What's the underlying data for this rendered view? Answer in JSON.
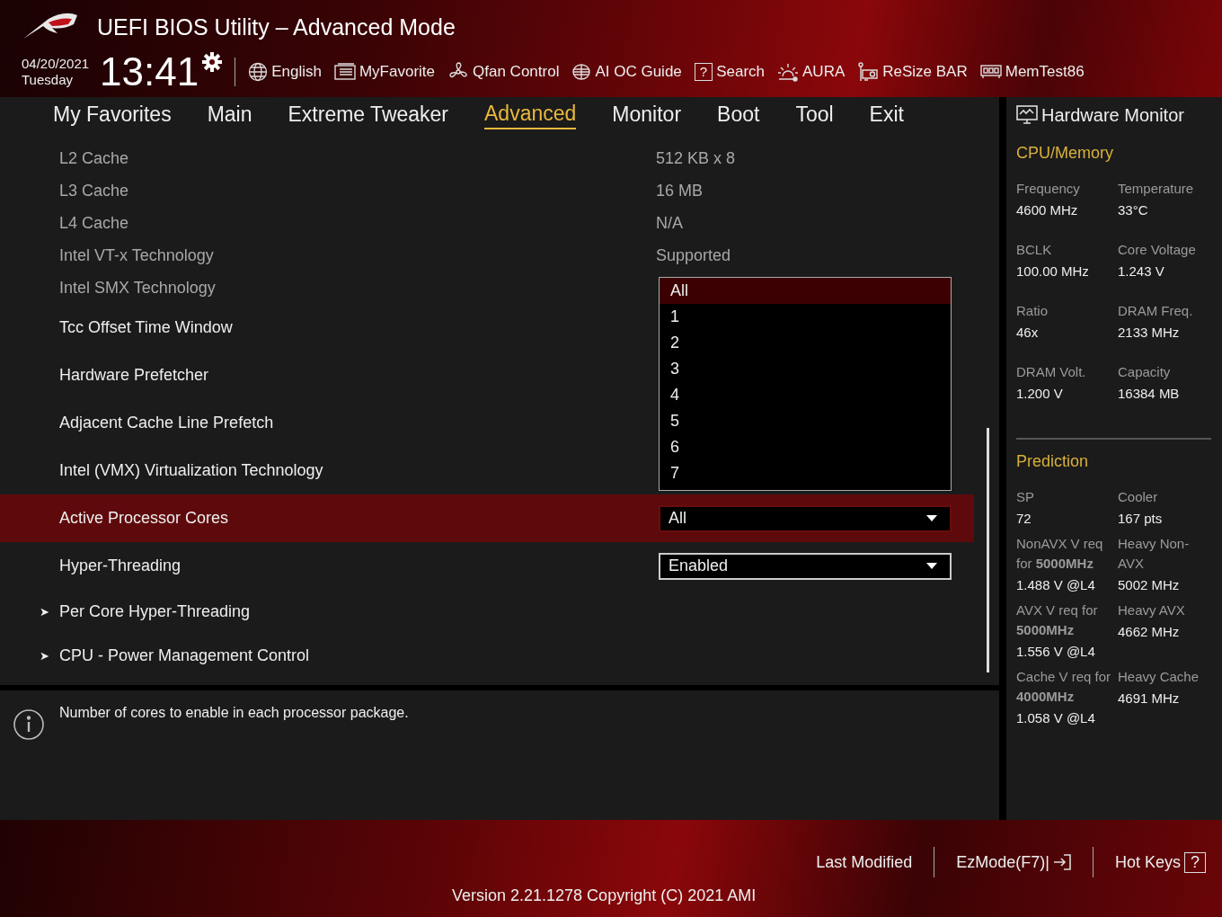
{
  "window": {
    "title": "UEFI BIOS Utility – Advanced Mode"
  },
  "clock": {
    "date": "04/20/2021",
    "day": "Tuesday",
    "time": "13:41"
  },
  "toolbar": [
    {
      "label": "English"
    },
    {
      "label": "MyFavorite"
    },
    {
      "label": "Qfan Control"
    },
    {
      "label": "AI OC Guide"
    },
    {
      "label": "Search",
      "glyph": "?"
    },
    {
      "label": "AURA"
    },
    {
      "label": "ReSize BAR"
    },
    {
      "label": "MemTest86"
    }
  ],
  "tabs": [
    {
      "label": "My Favorites",
      "selected": false
    },
    {
      "label": "Main",
      "selected": false
    },
    {
      "label": "Extreme Tweaker",
      "selected": false
    },
    {
      "label": "Advanced",
      "selected": true
    },
    {
      "label": "Monitor",
      "selected": false
    },
    {
      "label": "Boot",
      "selected": false
    },
    {
      "label": "Tool",
      "selected": false
    },
    {
      "label": "Exit",
      "selected": false
    }
  ],
  "settings": [
    {
      "kind": "info",
      "label": "L2 Cache",
      "value": "512 KB x 8"
    },
    {
      "kind": "info",
      "label": "L3 Cache",
      "value": "16 MB"
    },
    {
      "kind": "info",
      "label": "L4 Cache",
      "value": "N/A"
    },
    {
      "kind": "info",
      "label": "Intel VT-x Technology",
      "value": "Supported"
    },
    {
      "kind": "info",
      "label": "Intel SMX Technology"
    },
    {
      "kind": "setting",
      "label": "Tcc Offset Time Window"
    },
    {
      "kind": "setting",
      "label": "Hardware Prefetcher"
    },
    {
      "kind": "setting",
      "label": "Adjacent Cache Line Prefetch"
    },
    {
      "kind": "setting",
      "label": "Intel (VMX) Virtualization Technology"
    },
    {
      "kind": "dropdown",
      "label": "Active Processor Cores",
      "value": "All",
      "selected": true
    },
    {
      "kind": "dropdown",
      "label": "Hyper-Threading",
      "value": "Enabled",
      "selected": false
    },
    {
      "kind": "submenu",
      "label": "Per Core Hyper-Threading",
      "glyph": "➤"
    },
    {
      "kind": "submenu",
      "label": "CPU - Power Management Control",
      "glyph": "➤"
    }
  ],
  "dropdown_options": [
    {
      "label": "All",
      "selected": true
    },
    {
      "label": "1",
      "selected": false
    },
    {
      "label": "2",
      "selected": false
    },
    {
      "label": "3",
      "selected": false
    },
    {
      "label": "4",
      "selected": false
    },
    {
      "label": "5",
      "selected": false
    },
    {
      "label": "6",
      "selected": false
    },
    {
      "label": "7",
      "selected": false
    }
  ],
  "help": {
    "text": "Number of cores to enable in each processor package."
  },
  "hardware_monitor": {
    "title": "Hardware Monitor",
    "sections": [
      {
        "title": "CPU/Memory",
        "items": [
          {
            "label": "Frequency",
            "value": "4600 MHz"
          },
          {
            "label": "Temperature",
            "value": "33°C"
          },
          {
            "label": "BCLK",
            "value": "100.00 MHz"
          },
          {
            "label": "Core Voltage",
            "value": "1.243 V"
          },
          {
            "label": "Ratio",
            "value": "46x"
          },
          {
            "label": "DRAM Freq.",
            "value": "2133 MHz"
          },
          {
            "label": "DRAM Volt.",
            "value": "1.200 V"
          },
          {
            "label": "Capacity",
            "value": "16384 MB"
          }
        ]
      },
      {
        "title": "Prediction",
        "items": [
          {
            "label": "SP",
            "value": "72"
          },
          {
            "label": "Cooler",
            "value": "167 pts"
          },
          {
            "label": "NonAVX V req for **5000MHz**",
            "value": "1.488 V @L4"
          },
          {
            "label": "Heavy Non-AVX",
            "value": "5002 MHz"
          },
          {
            "label": "AVX V req for **5000MHz**",
            "value": "1.556 V @L4"
          },
          {
            "label": "Heavy AVX",
            "value": "4662 MHz"
          },
          {
            "label": "Cache V req for **4000MHz**",
            "value": "1.058 V @L4"
          },
          {
            "label": "Heavy Cache",
            "value": "4691 MHz"
          }
        ]
      }
    ]
  },
  "footer": {
    "links": [
      {
        "label": "Last Modified"
      },
      {
        "label": "EzMode(F7)|"
      },
      {
        "label": "Hot Keys",
        "glyph": "?"
      }
    ],
    "version": "Version 2.21.1278 Copyright (C) 2021 AMI"
  }
}
